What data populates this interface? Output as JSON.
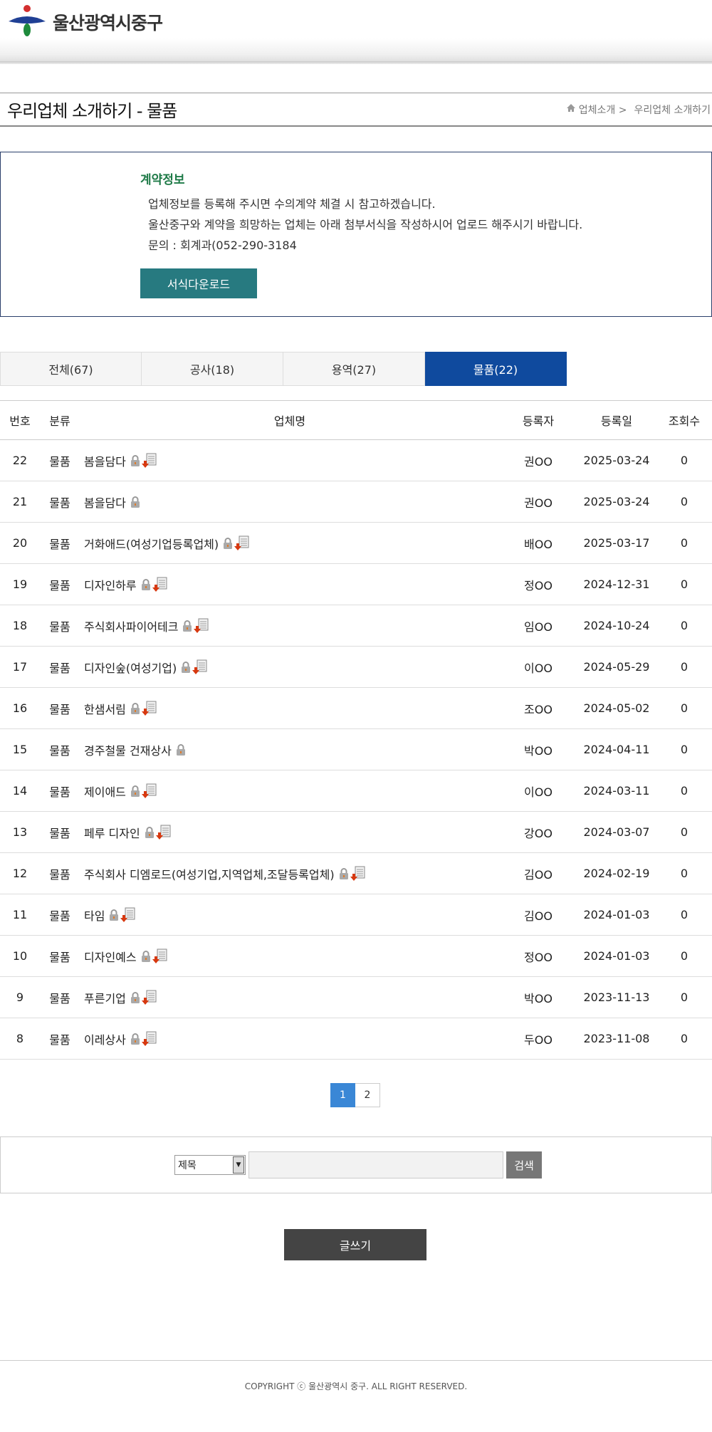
{
  "header": {
    "logo_text": "울산광역시중구"
  },
  "titlebar": {
    "title": "우리업체 소개하기 - 물품",
    "breadcrumb": [
      "업체소개 >",
      "우리업체 소개하기"
    ]
  },
  "info": {
    "title": "계약정보",
    "lines": [
      "업체정보를 등록해 주시면 수의계약 체결 시 참고하겠습니다.",
      "울산중구와 계약을 희망하는 업체는 아래 첨부서식을 작성하시어 업로드 해주시기 바랍니다.",
      "문의 : 회계과(052-290-3184"
    ],
    "download_label": "서식다운로드"
  },
  "tabs": [
    {
      "label": "전체(67)",
      "active": false
    },
    {
      "label": "공사(18)",
      "active": false
    },
    {
      "label": "용역(27)",
      "active": false
    },
    {
      "label": "물품(22)",
      "active": true
    }
  ],
  "table": {
    "headers": [
      "번호",
      "분류",
      "업체명",
      "등록자",
      "등록일",
      "조회수"
    ],
    "rows": [
      {
        "no": "22",
        "cat": "물품",
        "name": "봄을담다",
        "file": true,
        "reg": "권OO",
        "date": "2025-03-24",
        "views": "0"
      },
      {
        "no": "21",
        "cat": "물품",
        "name": "봄을담다",
        "file": false,
        "reg": "권OO",
        "date": "2025-03-24",
        "views": "0"
      },
      {
        "no": "20",
        "cat": "물품",
        "name": "거화애드(여성기업등록업체)",
        "file": true,
        "reg": "배OO",
        "date": "2025-03-17",
        "views": "0"
      },
      {
        "no": "19",
        "cat": "물품",
        "name": "디자인하루",
        "file": true,
        "reg": "정OO",
        "date": "2024-12-31",
        "views": "0"
      },
      {
        "no": "18",
        "cat": "물품",
        "name": "주식회사파이어테크",
        "file": true,
        "reg": "임OO",
        "date": "2024-10-24",
        "views": "0"
      },
      {
        "no": "17",
        "cat": "물품",
        "name": "디자인숲(여성기업)",
        "file": true,
        "reg": "이OO",
        "date": "2024-05-29",
        "views": "0"
      },
      {
        "no": "16",
        "cat": "물품",
        "name": "한샘서림",
        "file": true,
        "reg": "조OO",
        "date": "2024-05-02",
        "views": "0"
      },
      {
        "no": "15",
        "cat": "물품",
        "name": "경주철물 건재상사",
        "file": false,
        "reg": "박OO",
        "date": "2024-04-11",
        "views": "0"
      },
      {
        "no": "14",
        "cat": "물품",
        "name": "제이애드",
        "file": true,
        "reg": "이OO",
        "date": "2024-03-11",
        "views": "0"
      },
      {
        "no": "13",
        "cat": "물품",
        "name": "페루 디자인",
        "file": true,
        "reg": "강OO",
        "date": "2024-03-07",
        "views": "0"
      },
      {
        "no": "12",
        "cat": "물품",
        "name": "주식회사 디엠로드(여성기업,지역업체,조달등록업체)",
        "file": true,
        "reg": "김OO",
        "date": "2024-02-19",
        "views": "0"
      },
      {
        "no": "11",
        "cat": "물품",
        "name": "타임",
        "file": true,
        "reg": "김OO",
        "date": "2024-01-03",
        "views": "0"
      },
      {
        "no": "10",
        "cat": "물품",
        "name": "디자인예스",
        "file": true,
        "reg": "정OO",
        "date": "2024-01-03",
        "views": "0"
      },
      {
        "no": "9",
        "cat": "물품",
        "name": "푸른기업",
        "file": true,
        "reg": "박OO",
        "date": "2023-11-13",
        "views": "0"
      },
      {
        "no": "8",
        "cat": "물품",
        "name": "이레상사",
        "file": true,
        "reg": "두OO",
        "date": "2023-11-08",
        "views": "0"
      }
    ]
  },
  "pagination": {
    "pages": [
      "1",
      "2"
    ],
    "current": "1"
  },
  "search": {
    "select_value": "제목",
    "input_value": "",
    "button_label": "검색"
  },
  "write_label": "글쓰기",
  "footer": {
    "copyright": "COPYRIGHT ⓒ 울산광역시 중구. ALL RIGHT RESERVED."
  },
  "colors": {
    "active_tab": "#0f4a9e",
    "download_button": "#277a80",
    "info_title": "#1e7a47",
    "page_active": "#3a87d6"
  }
}
